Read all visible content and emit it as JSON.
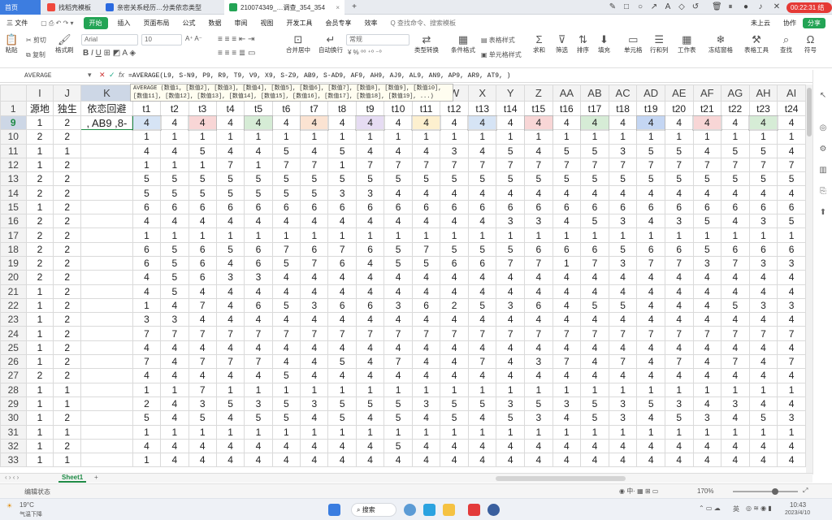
{
  "browser_tabs": [
    {
      "label": "首页",
      "color": "#ffffff"
    },
    {
      "label": "找稻壳模板",
      "color": "#f0493d"
    },
    {
      "label": "亲密关系经历…分类依恋类型",
      "color": "#2b6ae0"
    },
    {
      "label": "210074349_…调查_354_354",
      "color": "#23a455"
    }
  ],
  "timer": "00:22:31 结束",
  "menu": [
    "三 文件",
    "开始",
    "插入",
    "页面布局",
    "公式",
    "数据",
    "审阅",
    "视图",
    "开发工具",
    "会员专享",
    "效率",
    "Q 查找命令、搜索模板"
  ],
  "menu_right": [
    "未上云",
    "协作",
    "分享"
  ],
  "ribbon": {
    "paste": "粘贴",
    "cut": "剪切",
    "copy": "复制",
    "format_painter": "格式刷",
    "font_name": "Arial",
    "font_size": "10",
    "merge": "合并居中",
    "wrap": "自动换行",
    "number_format": "常规",
    "convert": "类型转换",
    "cond_format": "条件格式",
    "table_style": "表格样式",
    "cell_style": "单元格样式",
    "sum": "求和",
    "filter": "筛选",
    "sort": "排序",
    "fill": "填充",
    "cell": "单元格",
    "rowcol": "行和列",
    "sheet": "工作表",
    "freeze": "冻结窗格",
    "tools": "表格工具",
    "find": "查找",
    "symbol": "符号"
  },
  "name_box": "AVERAGE",
  "formula": "=AVERAGE(L9, S-N9, P9, R9, T9, V9, X9, S-Z9, AB9, S-AD9, AF9, AH9, AJ9, AL9, AN9, AP9, AR9, AT9, )",
  "tooltip_line1": "AVERAGE (数值1, [数值2], [数值3], [数值4], [数值5], [数值6], [数值7], [数值8], [数值9], [数值10],",
  "tooltip_line2": "[数值11], [数值12], [数值13], [数值14], [数值15], [数值16], [数值17], [数值18], [数值19], ...)",
  "columns": [
    "",
    "I",
    "J",
    "K",
    "L",
    "M",
    "N",
    "O",
    "P",
    "Q",
    "R",
    "S",
    "T",
    "U",
    "V",
    "W",
    "X",
    "Y",
    "Z",
    "AA",
    "AB",
    "AC",
    "AD",
    "AE",
    "AF",
    "AG",
    "AH",
    "AI"
  ],
  "header_row": [
    "1",
    "源地",
    "独生",
    "依恋回避",
    "t1",
    "t2",
    "t3",
    "t4",
    "t5",
    "t6",
    "t7",
    "t8",
    "t9",
    "t10",
    "t11",
    "t12",
    "t13",
    "t14",
    "t15",
    "t16",
    "t17",
    "t18",
    "t19",
    "t20",
    "t21",
    "t22",
    "t23",
    "t24"
  ],
  "edit_cell": ", AB9 ,8-",
  "rows": [
    [
      "9",
      "1",
      "2",
      "",
      4,
      4,
      4,
      4,
      4,
      4,
      4,
      4,
      4,
      4,
      4,
      4,
      4,
      4,
      4,
      4,
      4,
      4,
      4,
      4,
      4,
      4,
      4,
      4
    ],
    [
      "10",
      "2",
      "2",
      "",
      1,
      1,
      1,
      1,
      1,
      1,
      1,
      1,
      1,
      1,
      1,
      1,
      1,
      1,
      1,
      1,
      1,
      1,
      1,
      1,
      1,
      1,
      1,
      1
    ],
    [
      "11",
      "1",
      "1",
      "",
      4,
      4,
      5,
      4,
      4,
      5,
      4,
      5,
      4,
      4,
      4,
      3,
      4,
      5,
      4,
      5,
      5,
      3,
      5,
      5,
      4,
      5,
      5,
      4
    ],
    [
      "12",
      "1",
      "2",
      "",
      1,
      1,
      1,
      7,
      1,
      7,
      7,
      1,
      7,
      7,
      7,
      7,
      7,
      7,
      7,
      7,
      7,
      7,
      7,
      7,
      7,
      7,
      7,
      7
    ],
    [
      "13",
      "2",
      "2",
      "",
      5,
      5,
      5,
      5,
      5,
      5,
      5,
      5,
      5,
      5,
      5,
      5,
      5,
      5,
      5,
      5,
      5,
      5,
      5,
      5,
      5,
      5,
      5,
      5
    ],
    [
      "14",
      "2",
      "2",
      "",
      5,
      5,
      5,
      5,
      5,
      5,
      5,
      3,
      3,
      4,
      4,
      4,
      4,
      4,
      4,
      4,
      4,
      4,
      4,
      4,
      4,
      4,
      4,
      4
    ],
    [
      "15",
      "1",
      "2",
      "",
      6,
      6,
      6,
      6,
      6,
      6,
      6,
      6,
      6,
      6,
      6,
      6,
      6,
      6,
      6,
      6,
      6,
      6,
      6,
      6,
      6,
      6,
      6,
      6
    ],
    [
      "16",
      "2",
      "2",
      "",
      4,
      4,
      4,
      4,
      4,
      4,
      4,
      4,
      4,
      4,
      4,
      4,
      4,
      3,
      3,
      4,
      5,
      3,
      4,
      3,
      5,
      4,
      3,
      5
    ],
    [
      "17",
      "2",
      "2",
      "",
      1,
      1,
      1,
      1,
      1,
      1,
      1,
      1,
      1,
      1,
      1,
      1,
      1,
      1,
      1,
      1,
      1,
      1,
      1,
      1,
      1,
      1,
      1,
      1
    ],
    [
      "18",
      "2",
      "2",
      "",
      6,
      5,
      6,
      5,
      6,
      7,
      6,
      7,
      6,
      5,
      7,
      5,
      5,
      5,
      6,
      6,
      6,
      5,
      6,
      6,
      5,
      6,
      6,
      6
    ],
    [
      "19",
      "2",
      "2",
      "",
      6,
      5,
      6,
      4,
      6,
      5,
      7,
      6,
      4,
      5,
      5,
      6,
      6,
      7,
      7,
      1,
      7,
      3,
      7,
      7,
      3,
      7,
      3,
      3
    ],
    [
      "20",
      "2",
      "2",
      "",
      4,
      5,
      6,
      3,
      3,
      4,
      4,
      4,
      4,
      4,
      4,
      4,
      4,
      4,
      4,
      4,
      4,
      4,
      4,
      4,
      4,
      4,
      4,
      4
    ],
    [
      "21",
      "1",
      "2",
      "",
      4,
      5,
      4,
      4,
      4,
      4,
      4,
      4,
      4,
      4,
      4,
      4,
      4,
      4,
      4,
      4,
      4,
      4,
      4,
      4,
      4,
      4,
      4,
      4
    ],
    [
      "22",
      "1",
      "2",
      "",
      1,
      4,
      7,
      4,
      6,
      5,
      3,
      6,
      6,
      3,
      6,
      2,
      5,
      3,
      6,
      4,
      5,
      5,
      4,
      4,
      4,
      5,
      3,
      3
    ],
    [
      "23",
      "1",
      "2",
      "",
      3,
      3,
      4,
      4,
      4,
      4,
      4,
      4,
      4,
      4,
      4,
      4,
      4,
      4,
      4,
      4,
      4,
      4,
      4,
      4,
      4,
      4,
      4,
      4
    ],
    [
      "24",
      "1",
      "2",
      "",
      7,
      7,
      7,
      7,
      7,
      7,
      7,
      7,
      7,
      7,
      7,
      7,
      7,
      7,
      7,
      7,
      7,
      7,
      7,
      7,
      7,
      7,
      7,
      7
    ],
    [
      "25",
      "1",
      "2",
      "",
      4,
      4,
      4,
      4,
      4,
      4,
      4,
      4,
      4,
      4,
      4,
      4,
      4,
      4,
      4,
      4,
      4,
      4,
      4,
      4,
      4,
      4,
      4,
      4
    ],
    [
      "26",
      "1",
      "2",
      "",
      7,
      4,
      7,
      7,
      7,
      4,
      4,
      5,
      4,
      7,
      4,
      4,
      7,
      4,
      3,
      7,
      4,
      7,
      4,
      7,
      4,
      7,
      4,
      7
    ],
    [
      "27",
      "2",
      "2",
      "",
      4,
      4,
      4,
      4,
      4,
      5,
      4,
      4,
      4,
      4,
      4,
      4,
      4,
      4,
      4,
      4,
      4,
      4,
      4,
      4,
      4,
      4,
      4,
      4
    ],
    [
      "28",
      "1",
      "1",
      "",
      1,
      1,
      7,
      1,
      1,
      1,
      1,
      1,
      1,
      1,
      1,
      1,
      1,
      1,
      1,
      1,
      1,
      1,
      1,
      1,
      1,
      1,
      1,
      1
    ],
    [
      "29",
      "1",
      "1",
      "",
      2,
      4,
      3,
      5,
      3,
      5,
      3,
      5,
      5,
      5,
      3,
      5,
      5,
      3,
      5,
      3,
      5,
      3,
      5,
      3,
      4,
      3,
      4,
      4
    ],
    [
      "30",
      "1",
      "2",
      "",
      5,
      4,
      5,
      4,
      5,
      5,
      4,
      5,
      4,
      5,
      4,
      5,
      4,
      5,
      3,
      4,
      5,
      3,
      4,
      5,
      3,
      4,
      5,
      3
    ],
    [
      "31",
      "1",
      "1",
      "",
      1,
      1,
      1,
      1,
      1,
      1,
      1,
      1,
      1,
      1,
      1,
      1,
      1,
      1,
      1,
      1,
      1,
      1,
      1,
      1,
      1,
      1,
      1,
      1
    ],
    [
      "32",
      "1",
      "2",
      "",
      4,
      4,
      4,
      4,
      4,
      4,
      4,
      4,
      4,
      5,
      4,
      4,
      4,
      4,
      4,
      4,
      4,
      4,
      4,
      4,
      4,
      4,
      4,
      4
    ],
    [
      "33",
      "1",
      "1",
      "",
      1,
      4,
      4,
      4,
      4,
      4,
      4,
      4,
      4,
      4,
      4,
      4,
      4,
      4,
      4,
      4,
      4,
      4,
      4,
      4,
      4,
      4,
      4,
      4
    ]
  ],
  "ref_colors": {
    "L": "#d6e4f5",
    "N": "#f8d6d6",
    "P": "#d6ecd6",
    "R": "#fbe3d2",
    "T": "#e6dcf3",
    "V": "#fdf0cf",
    "X": "#d6e4f5",
    "Z": "#f8d6d6",
    "AB": "#d6ecd6",
    "AD": "#c4d6f3",
    "AF": "#f8d6d6",
    "AH": "#d6ecd6"
  },
  "sheet_tab": "Sheet1",
  "status_left": "编辑状态",
  "zoom": "170%",
  "taskbar": {
    "weather_temp": "19°C",
    "weather_desc": "气温下降",
    "search": "搜索",
    "lang": "英",
    "time": "10:43",
    "date": "2023/4/10"
  }
}
